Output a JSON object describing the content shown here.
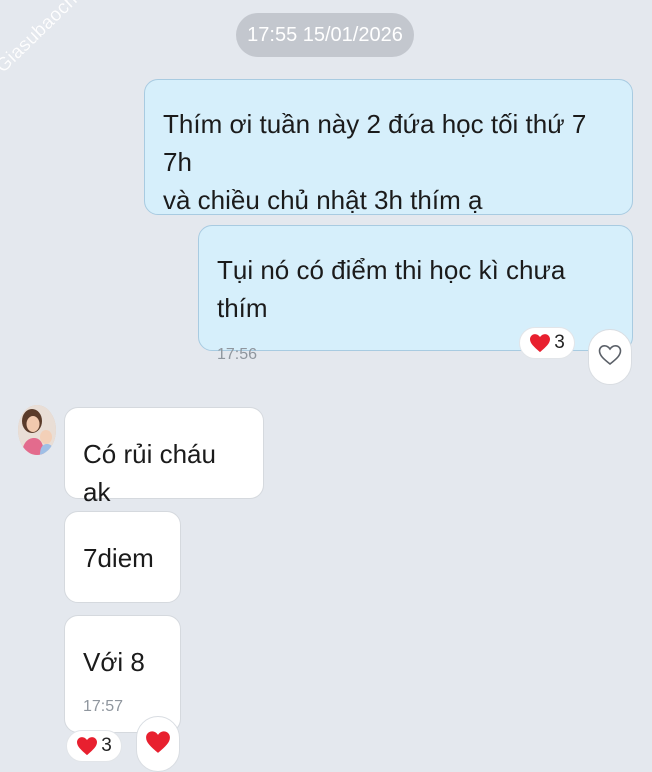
{
  "watermark": "Giasubaochau.net",
  "date_pill": "17:55 15/01/2026",
  "messages": [
    {
      "direction": "out",
      "lines": [
        "Thím ơi tuần này 2 đứa học tối thứ 7 7h",
        "và chiều chủ nhật 3h thím ạ"
      ]
    },
    {
      "direction": "out",
      "text": "Tụi nó có điểm thi học kì chưa thím",
      "time": "17:56",
      "reaction": {
        "icon": "red-heart-icon",
        "count": "3"
      },
      "react_button_icon": "heart-outline-icon"
    },
    {
      "direction": "in",
      "text": "Có rủi cháu ak"
    },
    {
      "direction": "in",
      "text": "7diem"
    },
    {
      "direction": "in",
      "text": "Với 8",
      "time": "17:57",
      "reaction": {
        "icon": "red-heart-icon",
        "count": "3"
      },
      "react_button_icon": "red-heart-icon"
    }
  ],
  "colors": {
    "background": "#e4e8ee",
    "outgoing_bubble": "#d6effb",
    "incoming_bubble": "#ffffff",
    "heart": "#e8202f"
  }
}
